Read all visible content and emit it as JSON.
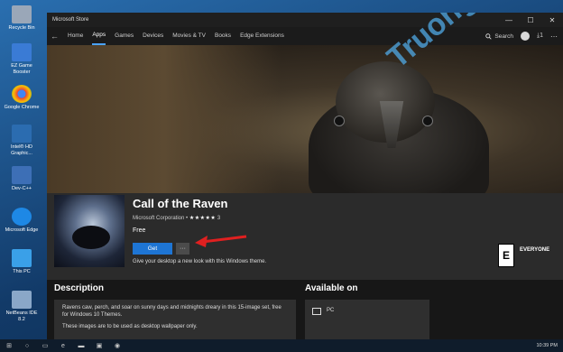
{
  "desktop": {
    "icons": [
      {
        "label": "Recycle Bin",
        "color": "#9aa7b8"
      },
      {
        "label": "EZ Game Booster",
        "color": "#3a7bd5"
      },
      {
        "label": "Google Chrome",
        "color": "#e8e8e8"
      },
      {
        "label": "Intel® HD Graphic...",
        "color": "#2b6cb0"
      },
      {
        "label": "Dev-C++",
        "color": "#3d6fb6"
      },
      {
        "label": "Microsoft Edge",
        "color": "#1e88e5"
      },
      {
        "label": "This PC",
        "color": "#3aa0e8"
      },
      {
        "label": "NetBeans IDE 8.2",
        "color": "#8aa7c8"
      }
    ]
  },
  "window": {
    "title": "Microsoft Store",
    "controls": {
      "minimize": "—",
      "maximize": "☐",
      "close": "✕"
    }
  },
  "nav": {
    "back": "←",
    "items": [
      "Home",
      "Apps",
      "Games",
      "Devices",
      "Movies & TV",
      "Books",
      "Edge Extensions"
    ],
    "active_index": 1,
    "search_label": "Search",
    "downloads_badge": "⤓1",
    "more": "⋯"
  },
  "app": {
    "title": "Call of the Raven",
    "publisher": "Microsoft Corporation",
    "stars": "★★★★★",
    "rating_count": "3",
    "price": "Free",
    "get_label": "Get",
    "more_label": "···",
    "tagline": "Give your desktop a new look with this Windows theme.",
    "esrb_letter": "E",
    "esrb_rating": "EVERYONE"
  },
  "description": {
    "heading": "Description",
    "text": "Ravens caw, perch, and soar on sunny days and midnights dreary in this 15-image set, free for Windows 10 Themes.",
    "text2": "These images are to be used as desktop wallpaper only."
  },
  "availability": {
    "heading": "Available on",
    "platform": "PC"
  },
  "watermark": "Truongtin.top",
  "taskbar": {
    "time": "10:39 PM",
    "accent": "#e02020"
  }
}
